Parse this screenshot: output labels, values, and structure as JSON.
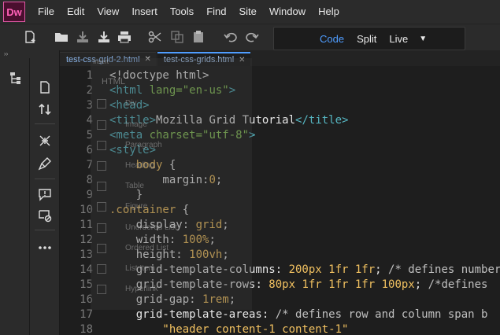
{
  "app": {
    "logo": "Dw"
  },
  "menu": [
    "File",
    "Edit",
    "View",
    "Insert",
    "Tools",
    "Find",
    "Site",
    "Window",
    "Help"
  ],
  "view_switch": {
    "options": [
      "Code",
      "Split",
      "Live"
    ],
    "active": "Code"
  },
  "left_strip": {
    "top_label": "››"
  },
  "tabs": [
    {
      "label": "test-css-grid-2.html",
      "active": false
    },
    {
      "label": "test-css-grids.html",
      "active": true
    }
  ],
  "insert_panel": {
    "title": "Insert",
    "category": "HTML",
    "items": [
      "Div",
      "Image",
      "Paragraph",
      "Heading",
      "Table",
      "Figure",
      "Unordered List",
      "Ordered List",
      "List Item",
      "Hyperlink"
    ]
  },
  "code_lines": [
    {
      "n": "1",
      "tokens": [
        [
          "t-text",
          "<!doctype html>"
        ]
      ]
    },
    {
      "n": "2",
      "tokens": [
        [
          "t-tag",
          "<html "
        ],
        [
          "t-attr",
          "lang="
        ],
        [
          "t-str",
          "\"en-us\""
        ],
        [
          "t-tag",
          ">"
        ]
      ]
    },
    {
      "n": "3",
      "tokens": [
        [
          "t-tag",
          "<head>"
        ]
      ]
    },
    {
      "n": "4",
      "tokens": [
        [
          "t-tag",
          "<title>"
        ],
        [
          "t-text",
          "Mozilla Grid Tutorial"
        ],
        [
          "t-tag",
          "</title>"
        ]
      ]
    },
    {
      "n": "5",
      "tokens": [
        [
          "t-tag",
          "<meta "
        ],
        [
          "t-attr",
          "charset="
        ],
        [
          "t-str",
          "\"utf-8\""
        ],
        [
          "t-tag",
          ">"
        ]
      ]
    },
    {
      "n": "6",
      "tokens": [
        [
          "t-tag",
          "<style>"
        ]
      ]
    },
    {
      "n": "7",
      "tokens": [
        [
          "t-sel",
          "    body "
        ],
        [
          "t-pun",
          "{"
        ]
      ]
    },
    {
      "n": "8",
      "tokens": [
        [
          "t-prop",
          "        margin"
        ],
        [
          "t-pun",
          ":"
        ],
        [
          "t-val",
          "0"
        ],
        [
          "t-pun",
          ";"
        ]
      ]
    },
    {
      "n": "9",
      "tokens": [
        [
          "t-pun",
          "    }"
        ]
      ]
    },
    {
      "n": "10",
      "tokens": [
        [
          "t-sel",
          ".container "
        ],
        [
          "t-pun",
          "{"
        ]
      ]
    },
    {
      "n": "11",
      "tokens": [
        [
          "t-prop",
          "    display"
        ],
        [
          "t-pun",
          ": "
        ],
        [
          "t-val",
          "grid"
        ],
        [
          "t-pun",
          ";"
        ]
      ]
    },
    {
      "n": "12",
      "tokens": [
        [
          "t-prop",
          "    width"
        ],
        [
          "t-pun",
          ": "
        ],
        [
          "t-val",
          "100%"
        ],
        [
          "t-pun",
          ";"
        ]
      ]
    },
    {
      "n": "13",
      "tokens": [
        [
          "t-prop",
          "    height"
        ],
        [
          "t-pun",
          ": "
        ],
        [
          "t-val",
          "100vh"
        ],
        [
          "t-pun",
          ";"
        ]
      ]
    },
    {
      "n": "14",
      "tokens": [
        [
          "t-prop",
          "    grid-template-columns"
        ],
        [
          "t-pun",
          ": "
        ],
        [
          "t-val",
          "200px 1fr 1fr"
        ],
        [
          "t-pun",
          "; "
        ],
        [
          "t-cmt",
          "/* defines number of columns"
        ]
      ]
    },
    {
      "n": "15",
      "tokens": [
        [
          "t-prop",
          "    grid-template-rows"
        ],
        [
          "t-pun",
          ": "
        ],
        [
          "t-val",
          "80px 1fr 1fr 1fr 100px"
        ],
        [
          "t-pun",
          "; "
        ],
        [
          "t-cmt",
          "/*defines"
        ]
      ]
    },
    {
      "n": "16",
      "tokens": [
        [
          "t-prop",
          "    grid-gap"
        ],
        [
          "t-pun",
          ": "
        ],
        [
          "t-val",
          "1rem"
        ],
        [
          "t-pun",
          ";"
        ]
      ]
    },
    {
      "n": "17",
      "tokens": [
        [
          "t-prop",
          "    grid-template-areas"
        ],
        [
          "t-pun",
          ": "
        ],
        [
          "t-cmt",
          "/* defines row and column span b"
        ]
      ]
    },
    {
      "n": "18",
      "tokens": [
        [
          "t-quote",
          "        \"header content-1 content-1\""
        ]
      ]
    }
  ]
}
